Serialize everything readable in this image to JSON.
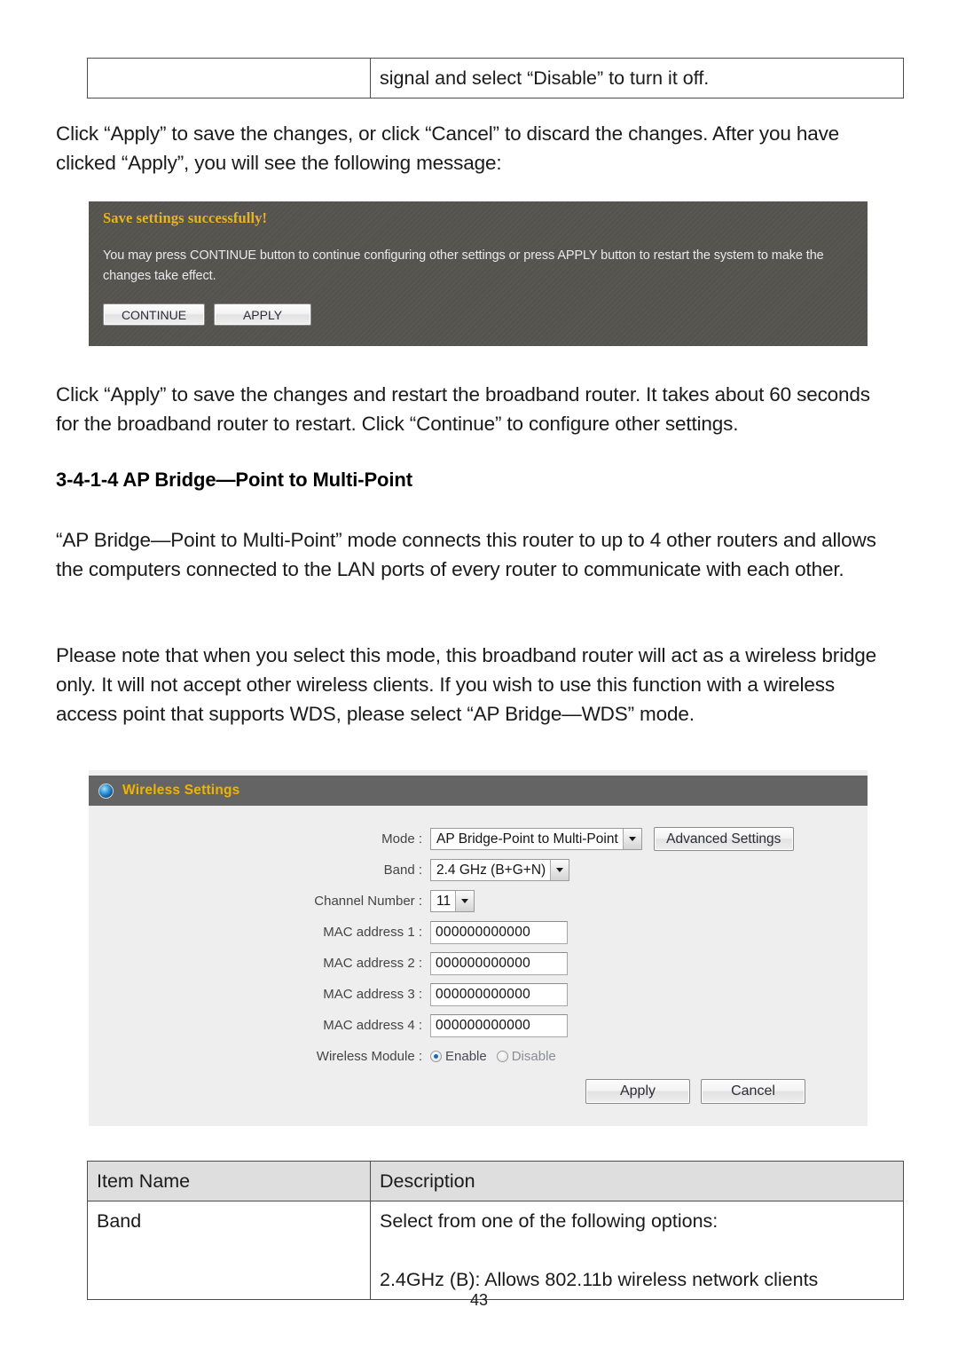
{
  "document": {
    "page_number": "43",
    "top_table": {
      "rows": [
        {
          "item": "",
          "description": "signal and select “Disable” to turn it off."
        }
      ]
    },
    "paragraphs": {
      "p1": "Click “Apply” to save the changes, or click “Cancel” to discard the changes. After you have clicked “Apply”, you will see the following message:",
      "p2": "Click “Apply” to save the changes and restart the broadband router. It takes about 60 seconds for the broadband router to restart. Click “Continue” to configure other settings.",
      "p3": "“AP Bridge—Point to Multi-Point” mode connects this router to up to 4 other routers and allows the computers connected to the LAN ports of every router to communicate with each other.",
      "p4": "Please note that when you select this mode, this broadband router will act as a wireless bridge only. It will not accept other wireless clients. If you wish to use this function with a wireless access point that supports WDS, please select “AP Bridge—WDS” mode."
    },
    "heading": "3-4-1-4 AP Bridge—Point to Multi-Point",
    "bottom_table": {
      "headers": {
        "item": "Item Name",
        "description": "Description"
      },
      "rows": [
        {
          "item": "Band",
          "description_line1": "Select from one of the following options:",
          "description_line2": "2.4GHz (B): Allows 802.11b wireless network clients"
        }
      ]
    }
  },
  "save_panel": {
    "title": "Save settings successfully!",
    "body": "You may press CONTINUE button to continue configuring other settings or press APPLY button to restart the system to make the changes take effect.",
    "continue_label": "CONTINUE",
    "apply_label": "APPLY",
    "background_color": "#55534e",
    "title_color": "#e8b421"
  },
  "wireless_settings": {
    "header": {
      "title": "Wireless Settings",
      "icon": "blue-bullet-icon",
      "bar_color": "#646464",
      "title_color": "#f0b400"
    },
    "fields": {
      "mode": {
        "label": "Mode :",
        "value": "AP Bridge-Point to Multi-Point"
      },
      "band": {
        "label": "Band :",
        "value": "2.4 GHz (B+G+N)"
      },
      "channel_number": {
        "label": "Channel Number :",
        "value": "11"
      },
      "mac_address_1": {
        "label": "MAC address 1 :",
        "value": "000000000000"
      },
      "mac_address_2": {
        "label": "MAC address 2 :",
        "value": "000000000000"
      },
      "mac_address_3": {
        "label": "MAC address 3 :",
        "value": "000000000000"
      },
      "mac_address_4": {
        "label": "MAC address 4 :",
        "value": "000000000000"
      },
      "wireless_module": {
        "label": "Wireless Module :",
        "enable_label": "Enable",
        "disable_label": "Disable",
        "selected": "Enable"
      }
    },
    "buttons": {
      "advanced_settings": "Advanced Settings",
      "apply": "Apply",
      "cancel": "Cancel"
    }
  }
}
